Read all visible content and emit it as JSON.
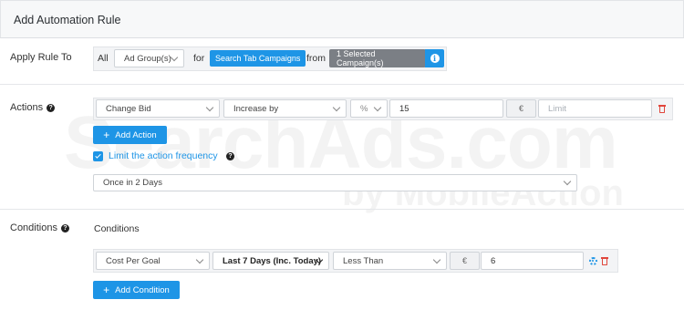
{
  "header": {
    "title": "Add Automation Rule"
  },
  "watermark": {
    "line1": "SearchAds.com",
    "line2": "by MobileAction"
  },
  "apply_rule": {
    "label": "Apply Rule To",
    "all_text": "All",
    "scope_select": "Ad Group(s)",
    "for_text": "for",
    "campaign_tag": "Search Tab Campaigns",
    "from_text": "from",
    "selected_campaigns": "1 Selected Campaign(s)"
  },
  "actions": {
    "label": "Actions",
    "action_type": "Change Bid",
    "direction": "Increase by",
    "unit": "%",
    "amount": "15",
    "currency": "€",
    "limit_placeholder": "Limit",
    "add_button": "Add Action",
    "limit_frequency_label": "Limit the action frequency",
    "frequency_select": "Once in 2 Days"
  },
  "conditions": {
    "label": "Conditions",
    "heading": "Conditions",
    "metric": "Cost Per Goal",
    "period": "Last 7 Days (Inc. Today)",
    "operator": "Less Than",
    "currency": "€",
    "value": "6",
    "add_button": "Add Condition"
  },
  "colors": {
    "accent": "#1e95e6",
    "danger": "#e0463c",
    "gray_tag": "#7b7f85"
  }
}
